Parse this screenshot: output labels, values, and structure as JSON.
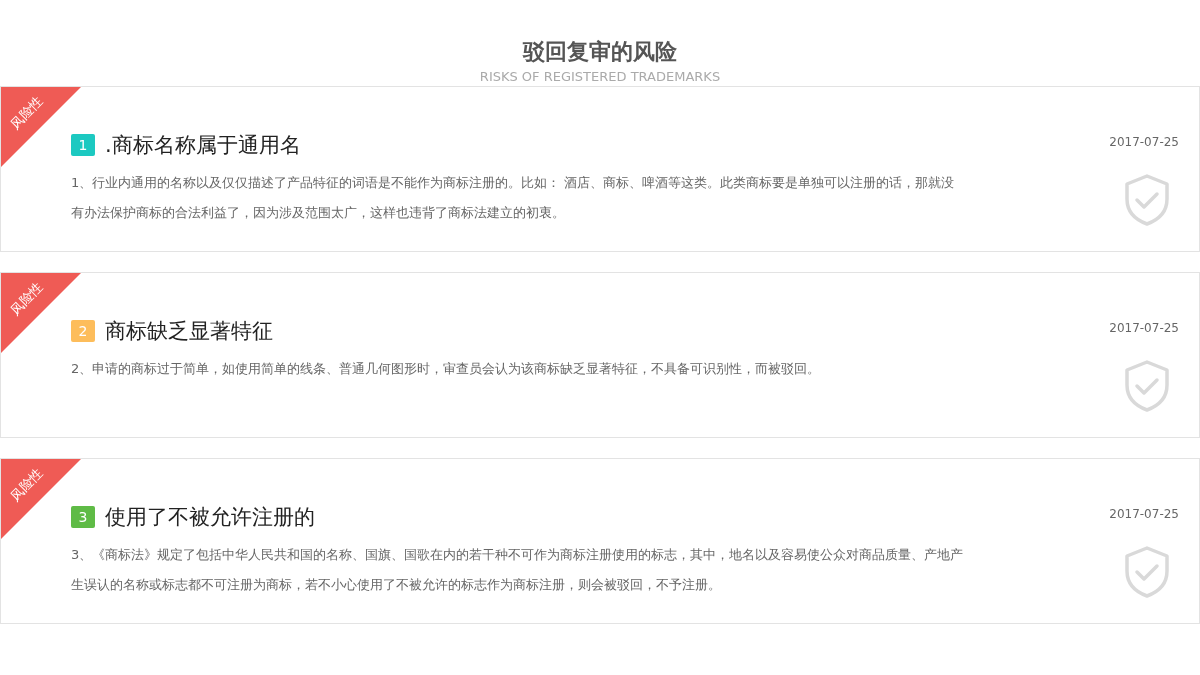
{
  "header": {
    "title": "驳回复审的风险",
    "subtitle": "RISKS OF REGISTERED TRADEMARKS"
  },
  "items": [
    {
      "ribbon": "风险性",
      "number": "1",
      "color": "#1cc9c1",
      "title": ".商标名称属于通用名",
      "date": "2017-07-25",
      "description": "1、行业内通用的名称以及仅仅描述了产品特征的词语是不能作为商标注册的。比如： 酒店、商标、啤酒等这类。此类商标要是单独可以注册的话，那就没有办法保护商标的合法利益了，因为涉及范围太广，这样也违背了商标法建立的初衷。"
    },
    {
      "ribbon": "风险性",
      "number": "2",
      "color": "#fdbd5b",
      "title": "商标缺乏显著特征",
      "date": "2017-07-25",
      "description": "2、申请的商标过于简单，如使用简单的线条、普通几何图形时，审查员会认为该商标缺乏显著特征，不具备可识别性，而被驳回。"
    },
    {
      "ribbon": "风险性",
      "number": "3",
      "color": "#5fbb46",
      "title": "使用了不被允许注册的",
      "date": "2017-07-25",
      "description": "3、《商标法》规定了包括中华人民共和国的名称、国旗、国歌在内的若干种不可作为商标注册使用的标志，其中，地名以及容易使公众对商品质量、产地产生误认的名称或标志都不可注册为商标，若不小心使用了不被允许的标志作为商标注册，则会被驳回，不予注册。"
    }
  ]
}
